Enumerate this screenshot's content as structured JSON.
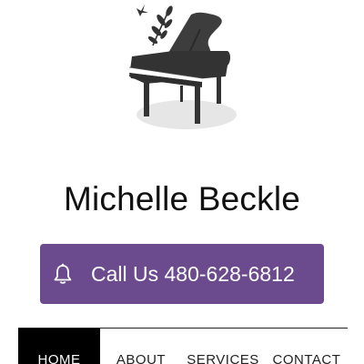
{
  "header": {
    "logo_icon": "grand-piano-with-plant-icon",
    "site_title": "Michelle Beckle"
  },
  "cta": {
    "icon": "bell-icon",
    "label": "Call Us 480-628-6812",
    "color": "#6b4a8e"
  },
  "nav": {
    "items": [
      {
        "label": "HOME",
        "active": true
      },
      {
        "label": "ABOUT",
        "active": false
      },
      {
        "label": "SERVICES",
        "active": false
      },
      {
        "label": "CONTACT",
        "active": false
      }
    ]
  }
}
